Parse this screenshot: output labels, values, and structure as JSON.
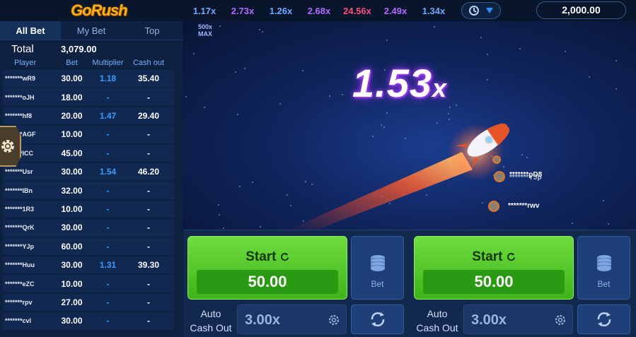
{
  "brand": {
    "logo_text": "GoRush"
  },
  "history": [
    {
      "value": "1.17x",
      "color": "#6fa8ff"
    },
    {
      "value": "2.73x",
      "color": "#b36bff"
    },
    {
      "value": "1.26x",
      "color": "#6fa8ff"
    },
    {
      "value": "2.68x",
      "color": "#b36bff"
    },
    {
      "value": "24.56x",
      "color": "#ff4d7a"
    },
    {
      "value": "2.49x",
      "color": "#b36bff"
    },
    {
      "value": "1.34x",
      "color": "#6fa8ff"
    }
  ],
  "balance": "2,000.00",
  "tabs": [
    {
      "label": "All Bet",
      "active": true
    },
    {
      "label": "My Bet",
      "active": false
    },
    {
      "label": "Top",
      "active": false
    }
  ],
  "total": {
    "label": "Total",
    "value": "3,079.00"
  },
  "columns": {
    "player": "Player",
    "bet": "Bet",
    "multiplier": "Multiplier",
    "cashout": "Cash out"
  },
  "bets": [
    {
      "player": "*******wR9",
      "bet": "30.00",
      "mult": "1.18",
      "cash": "35.40"
    },
    {
      "player": "*******oJH",
      "bet": "18.00",
      "mult": "-",
      "cash": "-"
    },
    {
      "player": "*******hf8",
      "bet": "20.00",
      "mult": "1.47",
      "cash": "29.40"
    },
    {
      "player": "*******AGF",
      "bet": "10.00",
      "mult": "-",
      "cash": "-"
    },
    {
      "player": "*******ICC",
      "bet": "45.00",
      "mult": "-",
      "cash": "-"
    },
    {
      "player": "*******Usr",
      "bet": "30.00",
      "mult": "1.54",
      "cash": "46.20"
    },
    {
      "player": "*******IBn",
      "bet": "32.00",
      "mult": "-",
      "cash": "-"
    },
    {
      "player": "*******1R3",
      "bet": "10.00",
      "mult": "-",
      "cash": "-"
    },
    {
      "player": "*******QrK",
      "bet": "30.00",
      "mult": "-",
      "cash": "-"
    },
    {
      "player": "*******YJp",
      "bet": "60.00",
      "mult": "-",
      "cash": "-"
    },
    {
      "player": "*******Huu",
      "bet": "30.00",
      "mult": "1.31",
      "cash": "39.30"
    },
    {
      "player": "*******eZC",
      "bet": "10.00",
      "mult": "-",
      "cash": "-"
    },
    {
      "player": "*******rpv",
      "bet": "27.00",
      "mult": "-",
      "cash": "-"
    },
    {
      "player": "*******cvl",
      "bet": "30.00",
      "mult": "-",
      "cash": "-"
    }
  ],
  "stage": {
    "max_label_top": "500x",
    "max_label_bottom": "MAX",
    "multiplier": "1.53",
    "multiplier_suffix": "x",
    "tags": [
      {
        "text": "*******pD8"
      },
      {
        "text": "*******YJp"
      },
      {
        "text": "*******rwv"
      }
    ]
  },
  "panels": [
    {
      "start_label": "Start",
      "amount": "50.00",
      "bet_label": "Bet",
      "auto_label_1": "Auto",
      "auto_label_2": "Cash Out",
      "auto_value": "3.00x"
    },
    {
      "start_label": "Start",
      "amount": "50.00",
      "bet_label": "Bet",
      "auto_label_1": "Auto",
      "auto_label_2": "Cash Out",
      "auto_value": "3.00x"
    }
  ]
}
